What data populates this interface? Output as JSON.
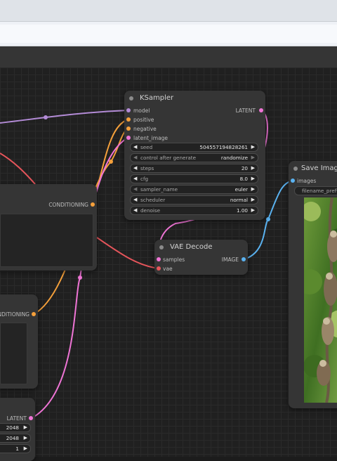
{
  "browser": {
    "top_right_text": ""
  },
  "nodes": {
    "ksampler": {
      "title": "KSampler",
      "inputs": [
        "model",
        "positive",
        "negative",
        "latent_image"
      ],
      "output": "LATENT",
      "widgets": [
        {
          "name": "seed",
          "value": "504557194828261"
        },
        {
          "name": "control after generate",
          "value": "randomize"
        },
        {
          "name": "steps",
          "value": "20"
        },
        {
          "name": "cfg",
          "value": "8.0"
        },
        {
          "name": "sampler_name",
          "value": "euler"
        },
        {
          "name": "scheduler",
          "value": "normal"
        },
        {
          "name": "denoise",
          "value": "1.00"
        }
      ]
    },
    "clip_positive": {
      "output": "CONDITIONING"
    },
    "clip_negative": {
      "output": "NDITIONING"
    },
    "empty_latent": {
      "output": "LATENT",
      "widgets": [
        {
          "value": "2048"
        },
        {
          "value": "2048"
        },
        {
          "value": "1"
        }
      ]
    },
    "vae_decode": {
      "title": "VAE Decode",
      "inputs": [
        "samples",
        "vae"
      ],
      "output": "IMAGE"
    },
    "save_image": {
      "title": "Save Image",
      "input": "images",
      "widget": "filename_prefix"
    }
  },
  "colors": {
    "model": "#b38bd6",
    "conditioning": "#f5a03b",
    "latent": "#f075d6",
    "vae": "#f26b6b",
    "image": "#5ab2f0",
    "clip_red": "#e6555b"
  }
}
